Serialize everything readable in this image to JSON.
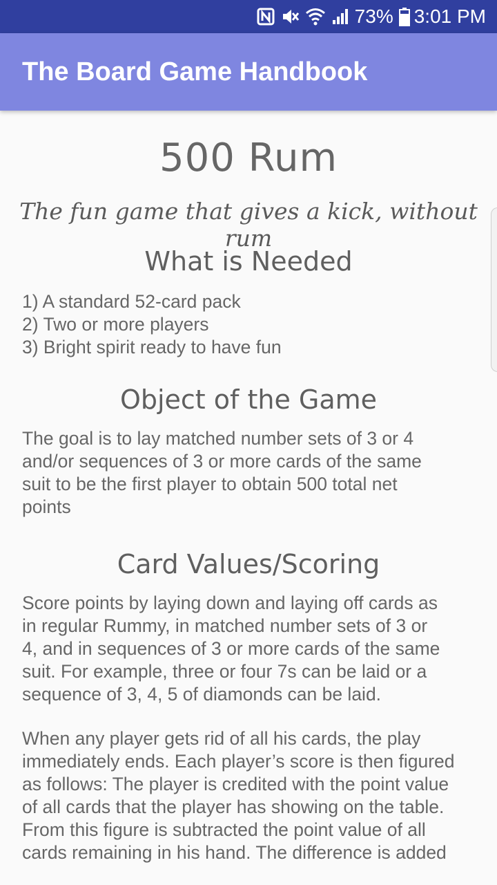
{
  "status_bar": {
    "battery_percent": "73%",
    "time": "3:01 PM",
    "icons": [
      "nfc-icon",
      "mute-icon",
      "wifi-icon",
      "signal-icon",
      "battery-icon"
    ]
  },
  "app_bar": {
    "title": "The Board Game Handbook"
  },
  "content": {
    "game_title": "500 Rum",
    "tagline": "The fun game that gives a kick, without rum",
    "sections": [
      {
        "heading": "What is Needed",
        "lines": [
          "1) A standard 52-card pack",
          "2) Two or more players",
          "3) Bright spirit ready to have fun"
        ]
      },
      {
        "heading": "Object of the Game",
        "lines": [
          "The goal is to lay matched number sets of 3 or 4",
          "and/or sequences of 3 or more cards of the same",
          "suit to be the first player to obtain 500 total net",
          "points"
        ]
      },
      {
        "heading": "Card Values/Scoring",
        "lines": [
          "Score points by laying down and laying off cards as",
          "in regular Rummy, in matched number sets of 3 or",
          "4, and in sequences of 3 or more cards of the same",
          "suit. For example, three or four 7s can be laid or a",
          "sequence of 3, 4, 5 of diamonds can be laid."
        ],
        "lines_2": [
          "When any player gets rid of all his cards, the play",
          "immediately ends. Each player’s score is then figured",
          "as follows: The player is credited with the point value",
          "of all cards that the player has showing on the table.",
          "From this figure is subtracted the point value of all",
          "cards remaining in his hand. The difference is added"
        ]
      }
    ]
  },
  "colors": {
    "status_bar": "#303F9F",
    "app_bar": "#7F86E0",
    "background": "#FAFAFA",
    "text": "#666666"
  }
}
